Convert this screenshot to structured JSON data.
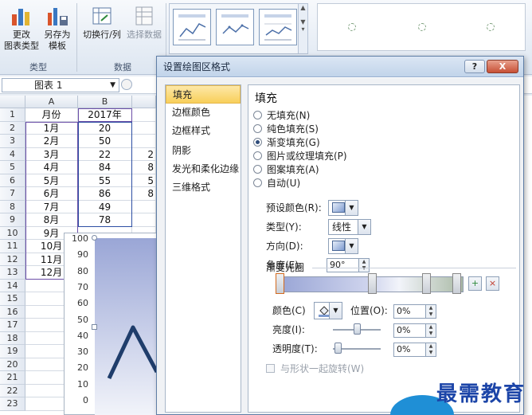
{
  "ribbon": {
    "change_type_label_1": "更改",
    "change_type_label_2": "图表类型",
    "save_template_label_1": "另存为",
    "save_template_label_2": "模板",
    "switch_row_col_label": "切换行/列",
    "select_data_label": "选择数据",
    "group_type": "类型",
    "group_data": "数据"
  },
  "formula_bar": {
    "name_box": "图表 1"
  },
  "sheet": {
    "columns": [
      "A",
      "B"
    ],
    "rows": [
      {
        "n": "1",
        "a": "月份",
        "b": "2017年"
      },
      {
        "n": "2",
        "a": "1月",
        "b": "20"
      },
      {
        "n": "3",
        "a": "2月",
        "b": "50"
      },
      {
        "n": "4",
        "a": "3月",
        "b": "22"
      },
      {
        "n": "5",
        "a": "4月",
        "b": "84"
      },
      {
        "n": "6",
        "a": "5月",
        "b": "55"
      },
      {
        "n": "7",
        "a": "6月",
        "b": "86"
      },
      {
        "n": "8",
        "a": "7月",
        "b": "49"
      },
      {
        "n": "9",
        "a": "8月",
        "b": "78"
      },
      {
        "n": "10",
        "a": "9月",
        "b": ""
      },
      {
        "n": "11",
        "a": "10月",
        "b": ""
      },
      {
        "n": "12",
        "a": "11月",
        "b": ""
      },
      {
        "n": "13",
        "a": "12月",
        "b": ""
      },
      {
        "n": "14",
        "a": "",
        "b": ""
      },
      {
        "n": "15",
        "a": "",
        "b": ""
      },
      {
        "n": "16",
        "a": "",
        "b": ""
      },
      {
        "n": "17",
        "a": "",
        "b": ""
      },
      {
        "n": "18",
        "a": "",
        "b": ""
      },
      {
        "n": "19",
        "a": "",
        "b": ""
      },
      {
        "n": "20",
        "a": "",
        "b": ""
      },
      {
        "n": "21",
        "a": "",
        "b": ""
      },
      {
        "n": "22",
        "a": "",
        "b": ""
      },
      {
        "n": "23",
        "a": "",
        "b": ""
      }
    ],
    "partial_c_values": [
      "2",
      "8",
      "5",
      "8"
    ]
  },
  "chart": {
    "y_ticks": [
      "100",
      "90",
      "80",
      "70",
      "60",
      "50",
      "40",
      "30",
      "20",
      "10",
      "0"
    ],
    "line_color": "#1f3d6b",
    "plot_gradient": [
      "#9aa6d6",
      "#f2f4fa"
    ]
  },
  "dialog": {
    "title": "设置绘图区格式",
    "help_label": "?",
    "close_label": "X",
    "nav": [
      "填充",
      "边框颜色",
      "边框样式",
      "阴影",
      "发光和柔化边缘",
      "三维格式"
    ],
    "active_nav": "填充",
    "panel_title": "填充",
    "fill_options": [
      {
        "label": "无填充(N)",
        "selected": false
      },
      {
        "label": "纯色填充(S)",
        "selected": false
      },
      {
        "label": "渐变填充(G)",
        "selected": true
      },
      {
        "label": "图片或纹理填充(P)",
        "selected": false
      },
      {
        "label": "图案填充(A)",
        "selected": false
      },
      {
        "label": "自动(U)",
        "selected": false
      }
    ],
    "preset_label": "预设颜色(R):",
    "type_label": "类型(Y):",
    "type_value": "线性",
    "direction_label": "方向(D):",
    "angle_label": "角度(E):",
    "angle_value": "90°",
    "gradient_stops_label": "渐变光圈",
    "color_label": "颜色(C)",
    "position_label": "位置(O):",
    "position_value": "0%",
    "brightness_label": "亮度(I):",
    "brightness_value": "0%",
    "transparency_label": "透明度(T):",
    "transparency_value": "0%",
    "rotate_label": "与形状一起旋转(W)"
  },
  "watermark": "最需教育"
}
